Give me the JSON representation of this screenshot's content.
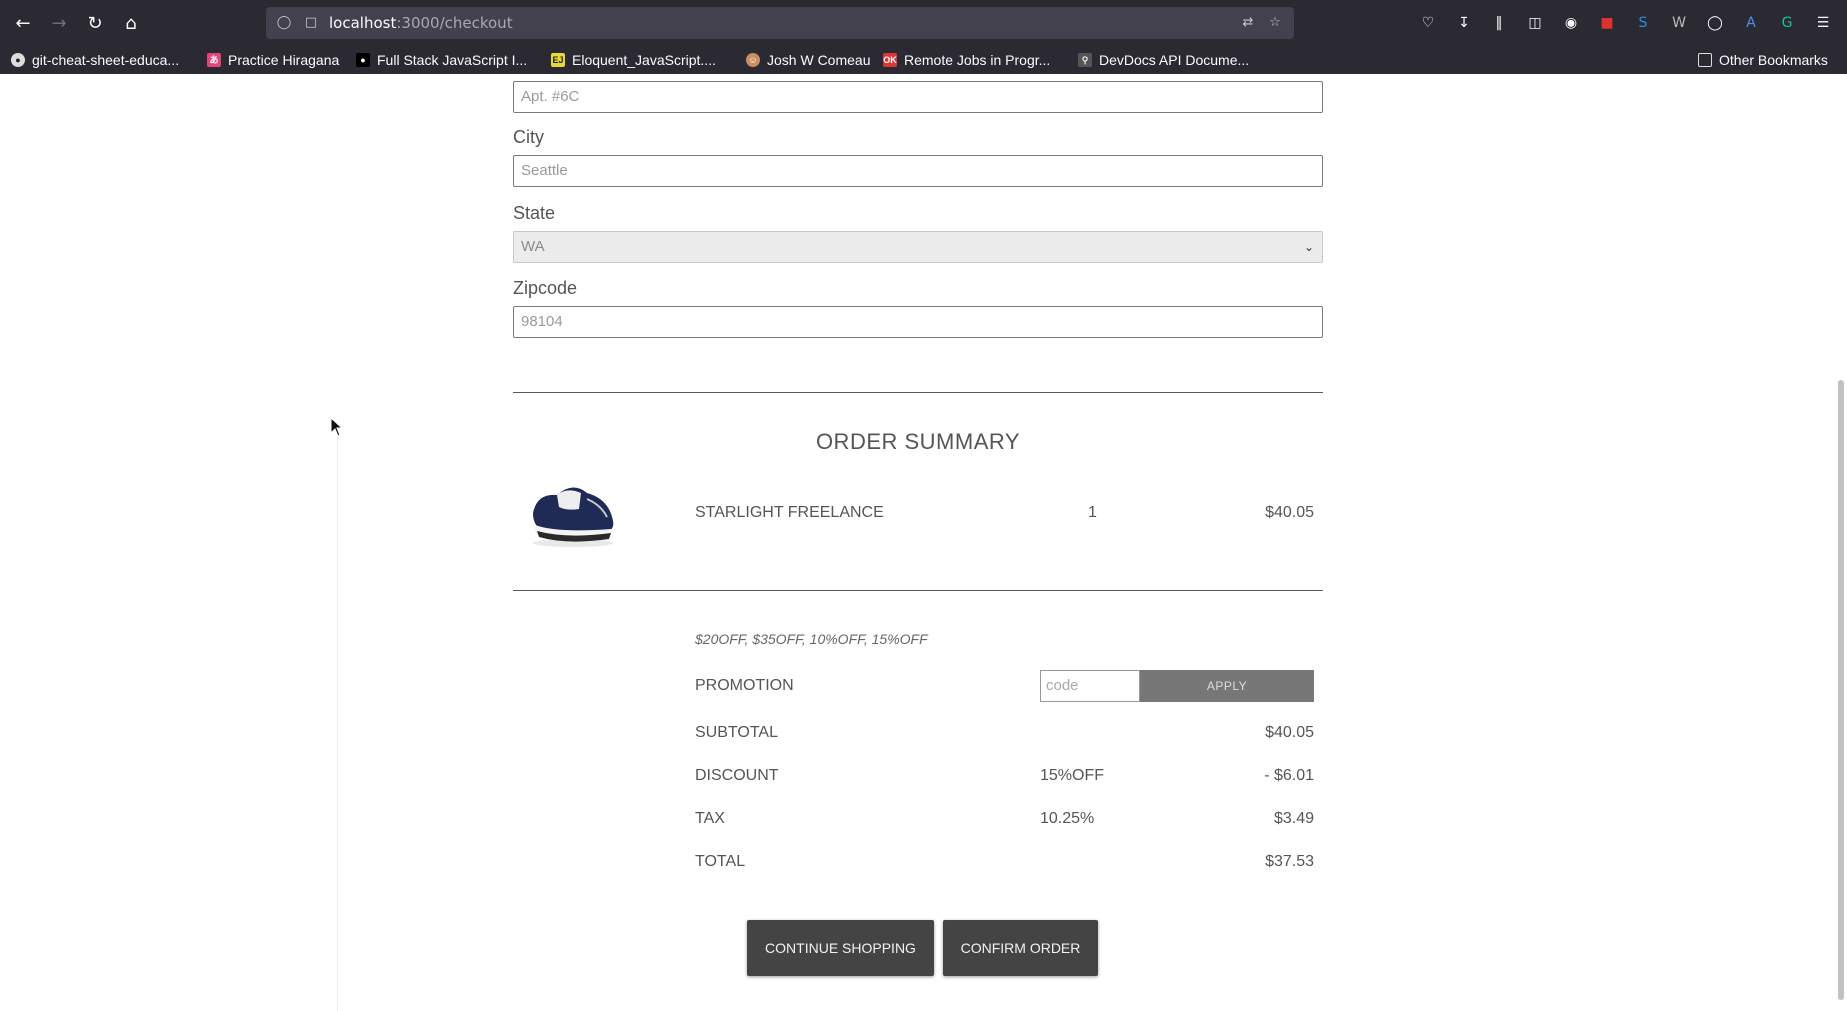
{
  "browser": {
    "url_host": "localhost",
    "url_path": ":3000/checkout",
    "bookmarks": [
      {
        "label": "git-cheat-sheet-educa...",
        "icon": "github-icon"
      },
      {
        "label": "Practice Hiragana",
        "icon": "hiragana-icon"
      },
      {
        "label": "Full Stack JavaScript I...",
        "icon": "medium-icon"
      },
      {
        "label": "Eloquent_JavaScript....",
        "icon": "ejs-icon"
      },
      {
        "label": "Josh W Comeau",
        "icon": "josh-avatar-icon"
      },
      {
        "label": "Remote Jobs in Progr...",
        "icon": "ok-icon"
      },
      {
        "label": "DevDocs API Docume...",
        "icon": "devdocs-icon"
      }
    ],
    "other_bookmarks": "Other Bookmarks"
  },
  "form": {
    "apt_placeholder": "Apt. #6C",
    "city_label": "City",
    "city_placeholder": "Seattle",
    "state_label": "State",
    "state_value": "WA",
    "zip_label": "Zipcode",
    "zip_placeholder": "98104"
  },
  "summary": {
    "title": "ORDER SUMMARY",
    "item": {
      "name": "STARLIGHT FREELANCE",
      "qty": "1",
      "price": "$40.05"
    },
    "promo_codes": "$20OFF, $35OFF, 10%OFF, 15%OFF",
    "promotion_label": "PROMOTION",
    "promo_input_placeholder": "code",
    "apply_label": "APPLY",
    "subtotal_label": "SUBTOTAL",
    "subtotal_value": "$40.05",
    "discount_label": "DISCOUNT",
    "discount_code": "15%OFF",
    "discount_value": "- $6.01",
    "tax_label": "TAX",
    "tax_rate": "10.25%",
    "tax_value": "$3.49",
    "total_label": "TOTAL",
    "total_value": "$37.53"
  },
  "actions": {
    "continue_label": "CONTINUE SHOPPING",
    "confirm_label": "CONFIRM ORDER"
  },
  "colors": {
    "chrome_bg": "#2b2a33",
    "urlbar_bg": "#42414d",
    "button_dark": "#444444",
    "apply_bg": "#777777"
  }
}
